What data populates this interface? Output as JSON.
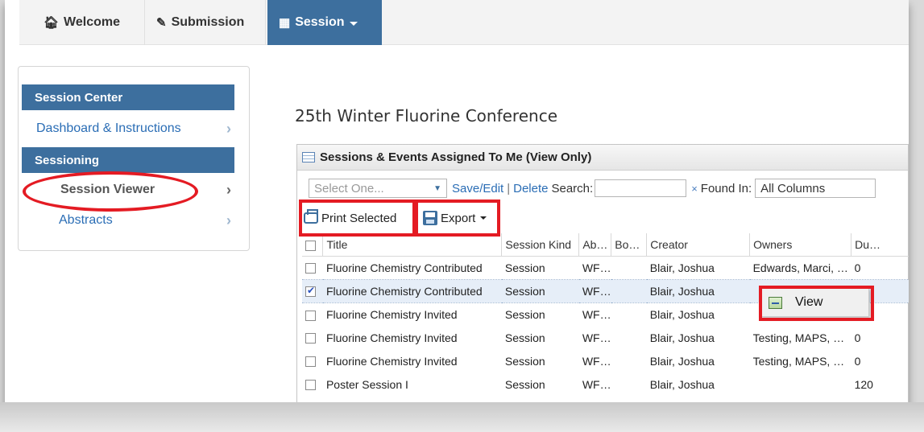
{
  "nav": {
    "tabs": [
      {
        "label": "Welcome",
        "icon": "home-icon"
      },
      {
        "label": "Submission",
        "icon": "pencil-icon"
      },
      {
        "label": "Session",
        "icon": "calendar-icon",
        "active": true
      }
    ]
  },
  "sidebar": {
    "sections": [
      {
        "heading": "Session Center",
        "items": [
          {
            "label": "Dashboard & Instructions"
          }
        ]
      },
      {
        "heading": "Sessioning",
        "items": [
          {
            "label": "Session Viewer",
            "selected": true
          },
          {
            "label": "Abstracts"
          }
        ]
      }
    ]
  },
  "main": {
    "conference_title": "25th Winter Fluorine Conference",
    "grid_title": "Sessions & Events Assigned To Me (View Only)",
    "toolbar": {
      "select_placeholder": "Select One...",
      "save_edit": "Save/Edit",
      "separator": "|",
      "delete": "Delete",
      "search_label": "Search:",
      "clear": "×",
      "found_in_label": "Found In:",
      "found_in_value": "All Columns",
      "print_selected": "Print Selected",
      "export": "Export"
    },
    "columns": [
      "Title",
      "Session Kind",
      "Ab…",
      "Bo…",
      "Creator",
      "Owners",
      "Du…"
    ],
    "rows": [
      {
        "checked": false,
        "cells": [
          "Fluorine Chemistry Contributed",
          "Session",
          "WF…",
          "",
          "Blair, Joshua",
          "Edwards, Marci, …",
          "0"
        ]
      },
      {
        "checked": true,
        "cells": [
          "Fluorine Chemistry Contributed",
          "Session",
          "WF…",
          "",
          "Blair, Joshua",
          "",
          ""
        ]
      },
      {
        "checked": false,
        "cells": [
          "Fluorine Chemistry Invited",
          "Session",
          "WF…",
          "",
          "Blair, Joshua",
          "",
          ""
        ]
      },
      {
        "checked": false,
        "cells": [
          "Fluorine Chemistry Invited",
          "Session",
          "WF…",
          "",
          "Blair, Joshua",
          "Testing, MAPS, …",
          "0"
        ]
      },
      {
        "checked": false,
        "cells": [
          "Fluorine Chemistry Invited",
          "Session",
          "WF…",
          "",
          "Blair, Joshua",
          "Testing, MAPS, …",
          "0"
        ]
      },
      {
        "checked": false,
        "cells": [
          "Poster Session I",
          "Session",
          "WF…",
          "",
          "Blair, Joshua",
          "",
          "120"
        ]
      }
    ],
    "context_menu": {
      "item": "View",
      "icon": "view-icon"
    }
  },
  "colors": {
    "brand": "#3d6f9e",
    "link": "#2a6db5",
    "highlight": "#e41b23"
  }
}
